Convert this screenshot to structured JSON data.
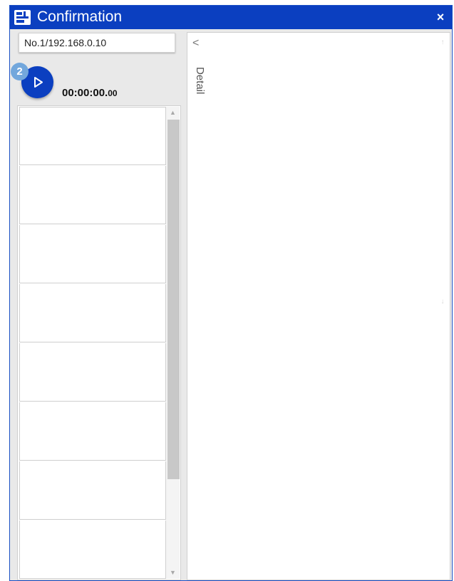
{
  "window": {
    "title": "Confirmation",
    "close_symbol": "×",
    "icon": "app-logo-icon",
    "accent": "#0b3fc0"
  },
  "left_pane": {
    "device_field_value": "No.1/192.168.0.10",
    "step_badge": "2",
    "play_icon": "play-icon",
    "timer_main": "00:00:00.",
    "timer_fraction": "00",
    "list_items": [
      "",
      "",
      "",
      "",
      "",
      "",
      "",
      ""
    ]
  },
  "right_pane": {
    "collapse_symbol": "<",
    "detail_label": "Detail"
  }
}
